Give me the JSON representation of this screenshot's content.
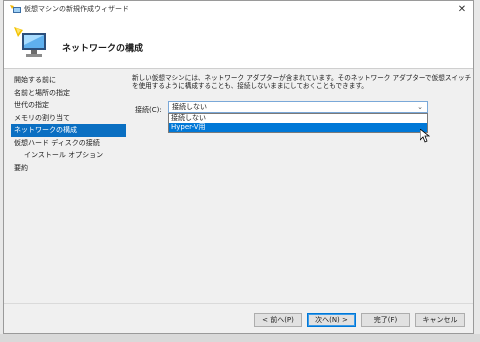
{
  "window": {
    "title": "仮想マシンの新規作成ウィザード",
    "close_glyph": "✕"
  },
  "header": {
    "title": "ネットワークの構成"
  },
  "sidebar": {
    "items": [
      {
        "label": "開始する前に"
      },
      {
        "label": "名前と場所の指定"
      },
      {
        "label": "世代の指定"
      },
      {
        "label": "メモリの割り当て"
      },
      {
        "label": "ネットワークの構成",
        "active": true
      },
      {
        "label": "仮想ハード ディスクの接続"
      },
      {
        "label": "インストール オプション",
        "indent": true
      },
      {
        "label": "要約"
      }
    ]
  },
  "main": {
    "description_line1": "新しい仮想マシンには、ネットワーク アダプターが含まれています。そのネットワーク アダプターで仮想スイッチ",
    "description_line2": "を使用するように構成することも、接続しないままにしておくこともできます。",
    "connection_label": "接続(C):",
    "connection_value": "接続しない",
    "options": [
      "接続しない",
      "Hyper-V用"
    ],
    "selected_option_index": 1
  },
  "footer": {
    "prev_label": "< 前へ(P)",
    "next_label": "次へ(N) >",
    "finish_label": "完了(F)",
    "cancel_label": "キャンセル"
  },
  "colors": {
    "accent": "#0078d7",
    "nav_active": "#0a6fc2"
  },
  "icons": {
    "title": "hyperv-wizard-icon",
    "header": "hyperv-monitor-icon",
    "dropdown": "chevron-down-icon",
    "cursor": "mouse-cursor-icon"
  }
}
